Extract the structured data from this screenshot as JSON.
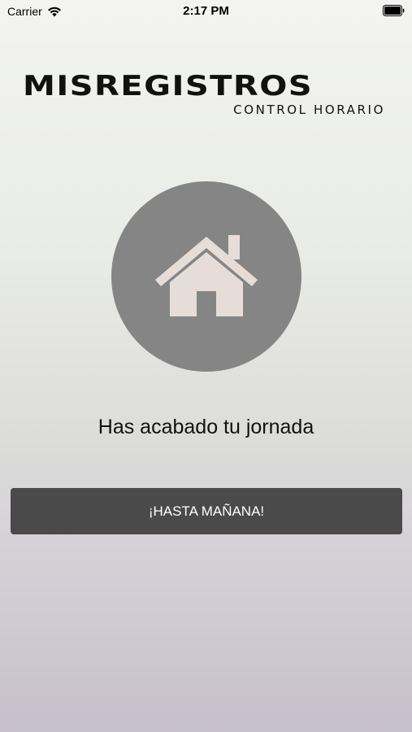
{
  "status_bar": {
    "carrier": "Carrier",
    "time": "2:17 PM"
  },
  "logo": {
    "title": "MISREGISTROS",
    "subtitle": "CONTROL HORARIO"
  },
  "status_icon": "home-icon",
  "message": "Has acabado tu jornada",
  "action_button": {
    "label": "¡HASTA MAÑANA!"
  },
  "colors": {
    "circle": "#858585",
    "house": "#e6ddd8",
    "button": "#4a4a4a",
    "button_text": "#ffffff"
  }
}
